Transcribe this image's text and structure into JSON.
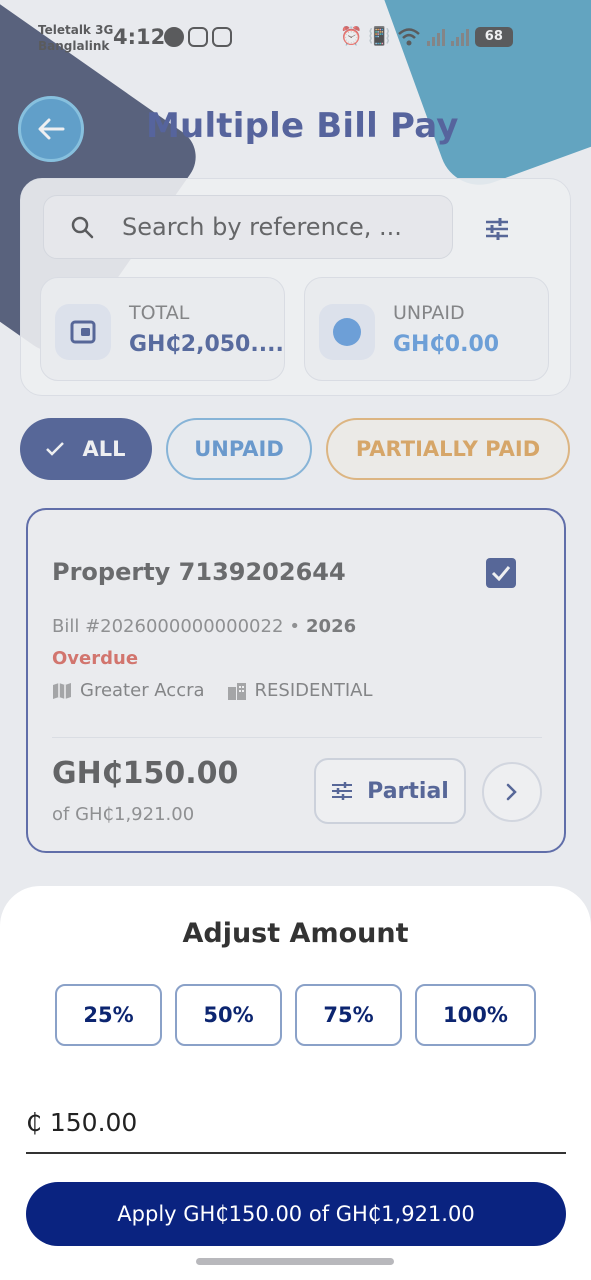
{
  "status_bar": {
    "carrier_1": "Teletalk 3G",
    "carrier_2": "Banglalink",
    "time": "4:12",
    "battery": "68"
  },
  "header": {
    "title": "Multiple Bill Pay",
    "back_icon": "arrow-left-icon"
  },
  "search": {
    "placeholder": "Search by reference, ..."
  },
  "summary": {
    "total_label": "TOTAL",
    "total_value": "GH₵2,050....",
    "unpaid_label": "UNPAID",
    "unpaid_value": "GH₵0.00"
  },
  "filters": {
    "all": "ALL",
    "unpaid": "UNPAID",
    "partially_paid": "PARTIALLY PAID"
  },
  "bill": {
    "title": "Property 7139202644",
    "bill_number": "Bill #2026000000000022",
    "separator": "•",
    "year": "2026",
    "status": "Overdue",
    "region": "Greater Accra",
    "category": "RESIDENTIAL",
    "amount": "GH₵150.00",
    "of_total": "of GH₵1,921.00",
    "partial_label": "Partial"
  },
  "sheet": {
    "title": "Adjust Amount",
    "presets": [
      "25%",
      "50%",
      "75%",
      "100%"
    ],
    "amount_value": "₵ 150.00",
    "apply_label": "Apply GH₵150.00 of GH₵1,921.00"
  },
  "colors": {
    "primary": "#0c2570",
    "accent_blue": "#1c7fbf",
    "overdue": "#d23a2c",
    "partial": "#d98a24"
  }
}
